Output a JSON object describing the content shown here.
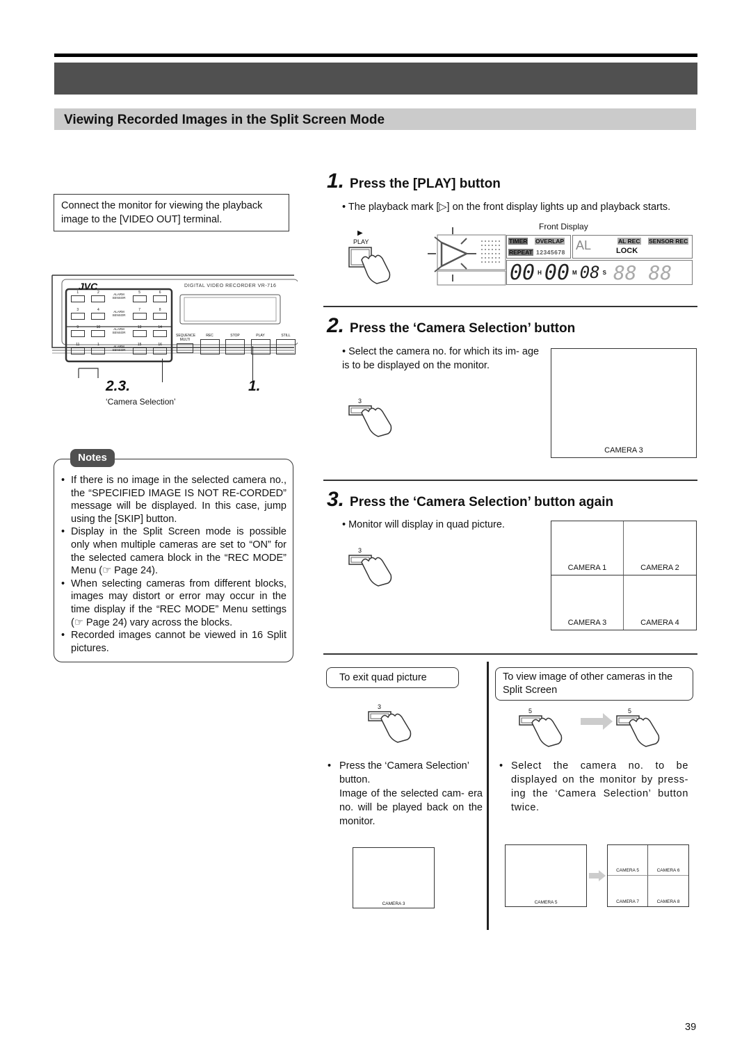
{
  "section": {
    "title": "Viewing Recorded Images in the Split Screen Mode"
  },
  "connect_note": "Connect the monitor for viewing the playback image to the [VIDEO OUT] terminal.",
  "device": {
    "brand": "JVC",
    "model_label": "DIGITAL VIDEO RECORDER VR-716",
    "camera_buttons": [
      "1",
      "2",
      "ALARM SENSOR",
      "5",
      "6",
      "3",
      "4",
      "ALARM SENSOR",
      "7",
      "8",
      "9",
      "10",
      "ALARM SENSOR",
      "13",
      "14",
      "11",
      "1",
      "ALARM SENSOR",
      "15",
      "16"
    ],
    "transport_buttons": [
      "SEQUENCE MULTI",
      "REC",
      "STOP",
      "PLAY",
      "STILL"
    ],
    "callout_left": "2.3.",
    "callout_right": "1.",
    "callout_caption": "‘Camera Selection’"
  },
  "notes": {
    "label": "Notes",
    "items": [
      "If there is no image in the selected camera no., the “SPECIFIED IMAGE IS NOT RE-CORDED” message will be displayed. In this case, jump using the [SKIP] button.",
      "Display in the Split Screen mode is possible only when multiple cameras are set to “ON” for the selected camera block in the “REC MODE” Menu (☞ Page 24).",
      "When selecting cameras from different blocks, images may distort or error may occur in the time display if the “REC MODE” Menu settings (☞ Page 24) vary across the blocks.",
      "Recorded images cannot be viewed in 16 Split pictures."
    ]
  },
  "steps": [
    {
      "num": "1.",
      "title": "Press the [PLAY] button",
      "bullet": "• The playback mark [▷] on the front display lights up and playback starts.",
      "button_label": "PLAY",
      "front_display": {
        "caption": "Front Display",
        "indicators": [
          "TIMER",
          "OVERLAP",
          "REPEAT",
          "12345678",
          "AL",
          "AL REC",
          "SENSOR REC",
          "LOCK"
        ],
        "time": {
          "h": "00",
          "m": "00",
          "s": "08",
          "h_unit": "H",
          "m_unit": "M",
          "s_unit": "S"
        }
      }
    },
    {
      "num": "2.",
      "title": "Press the ‘Camera Selection’ button",
      "bullet": "• Select the camera no. for which its im- age is to be displayed on the monitor.",
      "button_label": "3",
      "monitor": [
        "CAMERA 3"
      ]
    },
    {
      "num": "3.",
      "title": "Press the ‘Camera Selection’ button again",
      "bullet": "• Monitor will display in quad picture.",
      "button_label": "3",
      "monitor": [
        "CAMERA 1",
        "CAMERA 2",
        "CAMERA 3",
        "CAMERA 4"
      ]
    }
  ],
  "exit_quad": {
    "heading": "To exit quad picture",
    "button_label": "3",
    "text": "Press the ‘Camera Selection’ button.",
    "text2": "Image of the selected cam- era no. will be played back on the monitor.",
    "monitor": [
      "CAMERA 3"
    ]
  },
  "other_cameras": {
    "heading": "To view image of other cameras in the Split Screen",
    "button_label_1": "5",
    "button_label_2": "5",
    "text": "Select the camera no. to be displayed on the monitor by press- ing the ‘Camera Selection’ button twice.",
    "monitor_single": [
      "CAMERA 5"
    ],
    "monitor_quad": [
      "CAMERA 5",
      "CAMERA 6",
      "CAMERA 7",
      "CAMERA 8"
    ]
  },
  "page_number": "39"
}
